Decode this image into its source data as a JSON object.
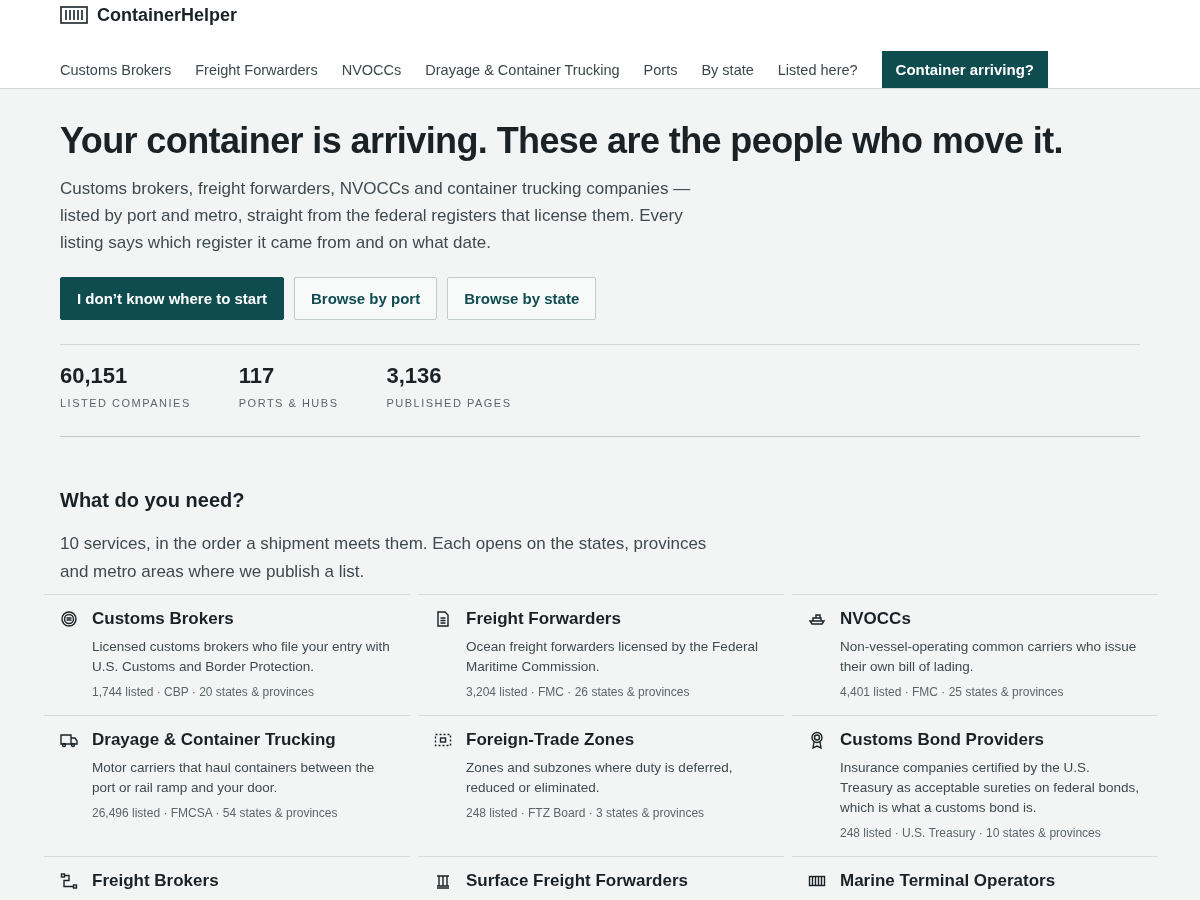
{
  "brand": {
    "name": "ContainerHelper"
  },
  "nav": [
    {
      "label": "Customs Brokers",
      "kind": "link"
    },
    {
      "label": "Freight Forwarders",
      "kind": "link"
    },
    {
      "label": "NVOCCs",
      "kind": "link"
    },
    {
      "label": "Drayage & Container Trucking",
      "kind": "link"
    },
    {
      "label": "Ports",
      "kind": "link"
    },
    {
      "label": "By state",
      "kind": "link"
    },
    {
      "label": "Listed here?",
      "kind": "link"
    },
    {
      "label": "Container arriving?",
      "kind": "cta"
    }
  ],
  "hero": {
    "title": "Your container is arriving. These are the people who move it.",
    "lead": "Customs brokers, freight forwarders, NVOCCs and container trucking companies — listed by port and metro, straight from the federal registers that license them. Every listing says which register it came from and on what date.",
    "buttons": [
      {
        "label": "I don’t know where to start",
        "kind": "primary"
      },
      {
        "label": "Browse by port",
        "kind": "secondary"
      },
      {
        "label": "Browse by state",
        "kind": "secondary"
      }
    ]
  },
  "stats": [
    {
      "value": "60,151",
      "label": "LISTED COMPANIES"
    },
    {
      "value": "117",
      "label": "PORTS & HUBS"
    },
    {
      "value": "3,136",
      "label": "PUBLISHED PAGES"
    }
  ],
  "services": {
    "title": "What do you need?",
    "intro": "10 services, in the order a shipment meets them. Each opens on the states, provinces and metro areas where we publish a list.",
    "cards": [
      {
        "title": "Customs Brokers",
        "description": "Licensed customs brokers who file your entry with U.S. Customs and Border Protection.",
        "meta": "1,744 listed · CBP · 20 states & provinces"
      },
      {
        "title": "Freight Forwarders",
        "description": "Ocean freight forwarders licensed by the Federal Maritime Commission.",
        "meta": "3,204 listed · FMC · 26 states & provinces"
      },
      {
        "title": "NVOCCs",
        "description": "Non-vessel-operating common carriers who issue their own bill of lading.",
        "meta": "4,401 listed · FMC · 25 states & provinces"
      },
      {
        "title": "Drayage & Container Trucking",
        "description": "Motor carriers that haul containers between the port or rail ramp and your door.",
        "meta": "26,496 listed · FMCSA · 54 states & provinces"
      },
      {
        "title": "Foreign-Trade Zones",
        "description": "Zones and subzones where duty is deferred, reduced or eliminated.",
        "meta": "248 listed · FTZ Board · 3 states & provinces"
      },
      {
        "title": "Customs Bond Providers",
        "description": "Insurance companies certified by the U.S. Treasury as acceptable sureties on federal bonds, which is what a customs bond is.",
        "meta": "248 listed · U.S. Treasury · 10 states & provinces"
      },
      {
        "title": "Freight Brokers"
      },
      {
        "title": "Surface Freight Forwarders"
      },
      {
        "title": "Marine Terminal Operators"
      }
    ]
  }
}
